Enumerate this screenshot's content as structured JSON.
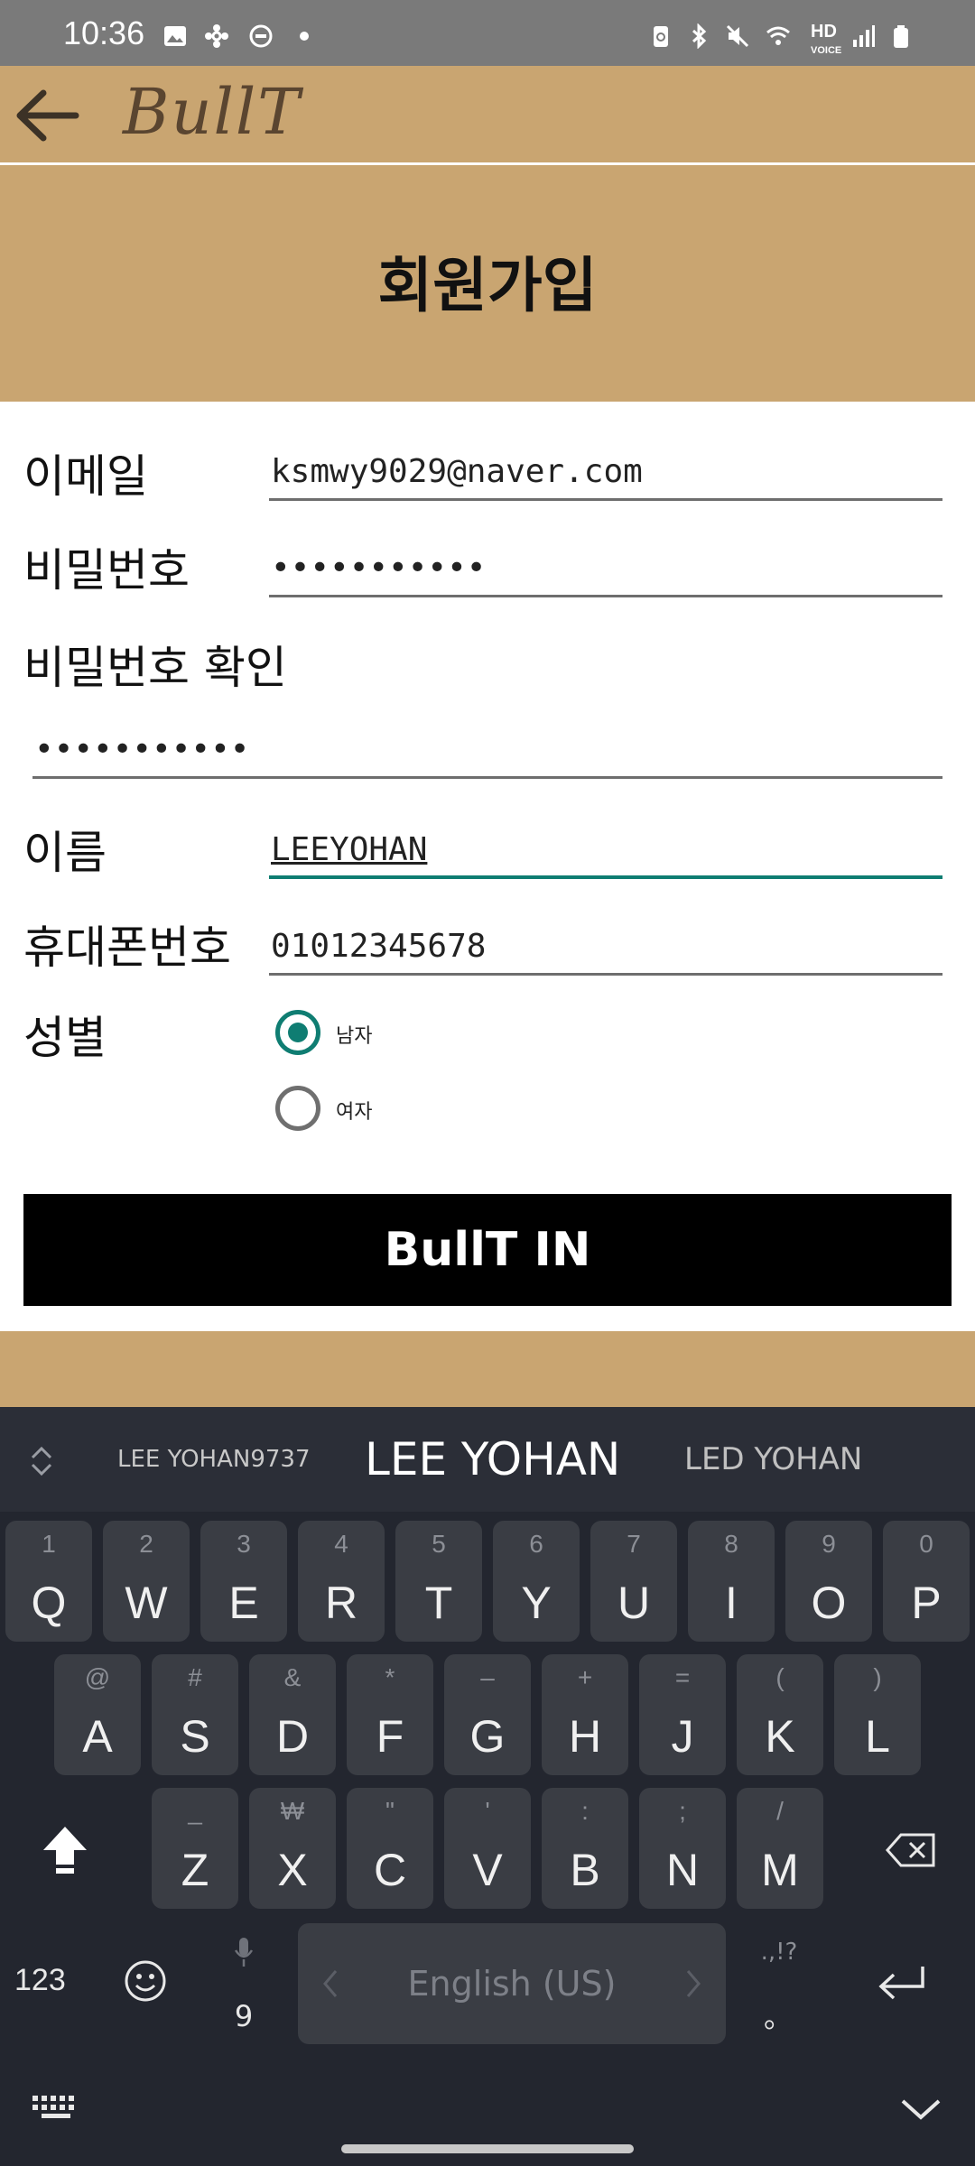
{
  "status_bar": {
    "time": "10:36"
  },
  "app_bar": {
    "logo": "BullT",
    "back_icon": "arrow-left-icon"
  },
  "header": {
    "title": "회원가입"
  },
  "form": {
    "email_label": "이메일",
    "email_value": "ksmwy9029@naver.com",
    "password_label": "비밀번호",
    "password_value": "•••••••••••",
    "password_confirm_label": "비밀번호 확인",
    "password_confirm_value": "•••••••••••",
    "name_label": "이름",
    "name_value": "LEEYOHAN",
    "phone_label": "휴대폰번호",
    "phone_value": "01012345678",
    "gender_label": "성별",
    "gender_options": [
      "남자",
      "여자"
    ],
    "gender_selected": "남자",
    "submit_label": "BullT IN"
  },
  "colors": {
    "brand_tan": "#c9a571",
    "accent_teal": "#0f7d72",
    "keyboard_bg": "#23262f"
  },
  "keyboard": {
    "suggestions": [
      "LEE YOHAN9737",
      "LEE YOHAN",
      "LED YOHAN"
    ],
    "row1": [
      {
        "k": "Q",
        "h": "1"
      },
      {
        "k": "W",
        "h": "2"
      },
      {
        "k": "E",
        "h": "3"
      },
      {
        "k": "R",
        "h": "4"
      },
      {
        "k": "T",
        "h": "5"
      },
      {
        "k": "Y",
        "h": "6"
      },
      {
        "k": "U",
        "h": "7"
      },
      {
        "k": "I",
        "h": "8"
      },
      {
        "k": "O",
        "h": "9"
      },
      {
        "k": "P",
        "h": "0"
      }
    ],
    "row2": [
      {
        "k": "A",
        "h": "@"
      },
      {
        "k": "S",
        "h": "#"
      },
      {
        "k": "D",
        "h": "&"
      },
      {
        "k": "F",
        "h": "*"
      },
      {
        "k": "G",
        "h": "–"
      },
      {
        "k": "H",
        "h": "+"
      },
      {
        "k": "J",
        "h": "="
      },
      {
        "k": "K",
        "h": "("
      },
      {
        "k": "L",
        "h": ")"
      }
    ],
    "row3": [
      {
        "k": "Z",
        "h": "_"
      },
      {
        "k": "X",
        "h": "₩"
      },
      {
        "k": "C",
        "h": "\""
      },
      {
        "k": "V",
        "h": "'"
      },
      {
        "k": "B",
        "h": ":"
      },
      {
        "k": "N",
        "h": ";"
      },
      {
        "k": "M",
        "h": "/"
      }
    ],
    "numbers_label": "123",
    "space_label": "English (US)",
    "comma_key": "9",
    "period_key": "。",
    "punct_hint": ".,!?",
    "icons": [
      "shift-icon",
      "backspace-icon",
      "emoji-icon",
      "mic-icon",
      "enter-icon",
      "keyboard-icon",
      "chevron-down-icon",
      "expand-icon"
    ]
  }
}
